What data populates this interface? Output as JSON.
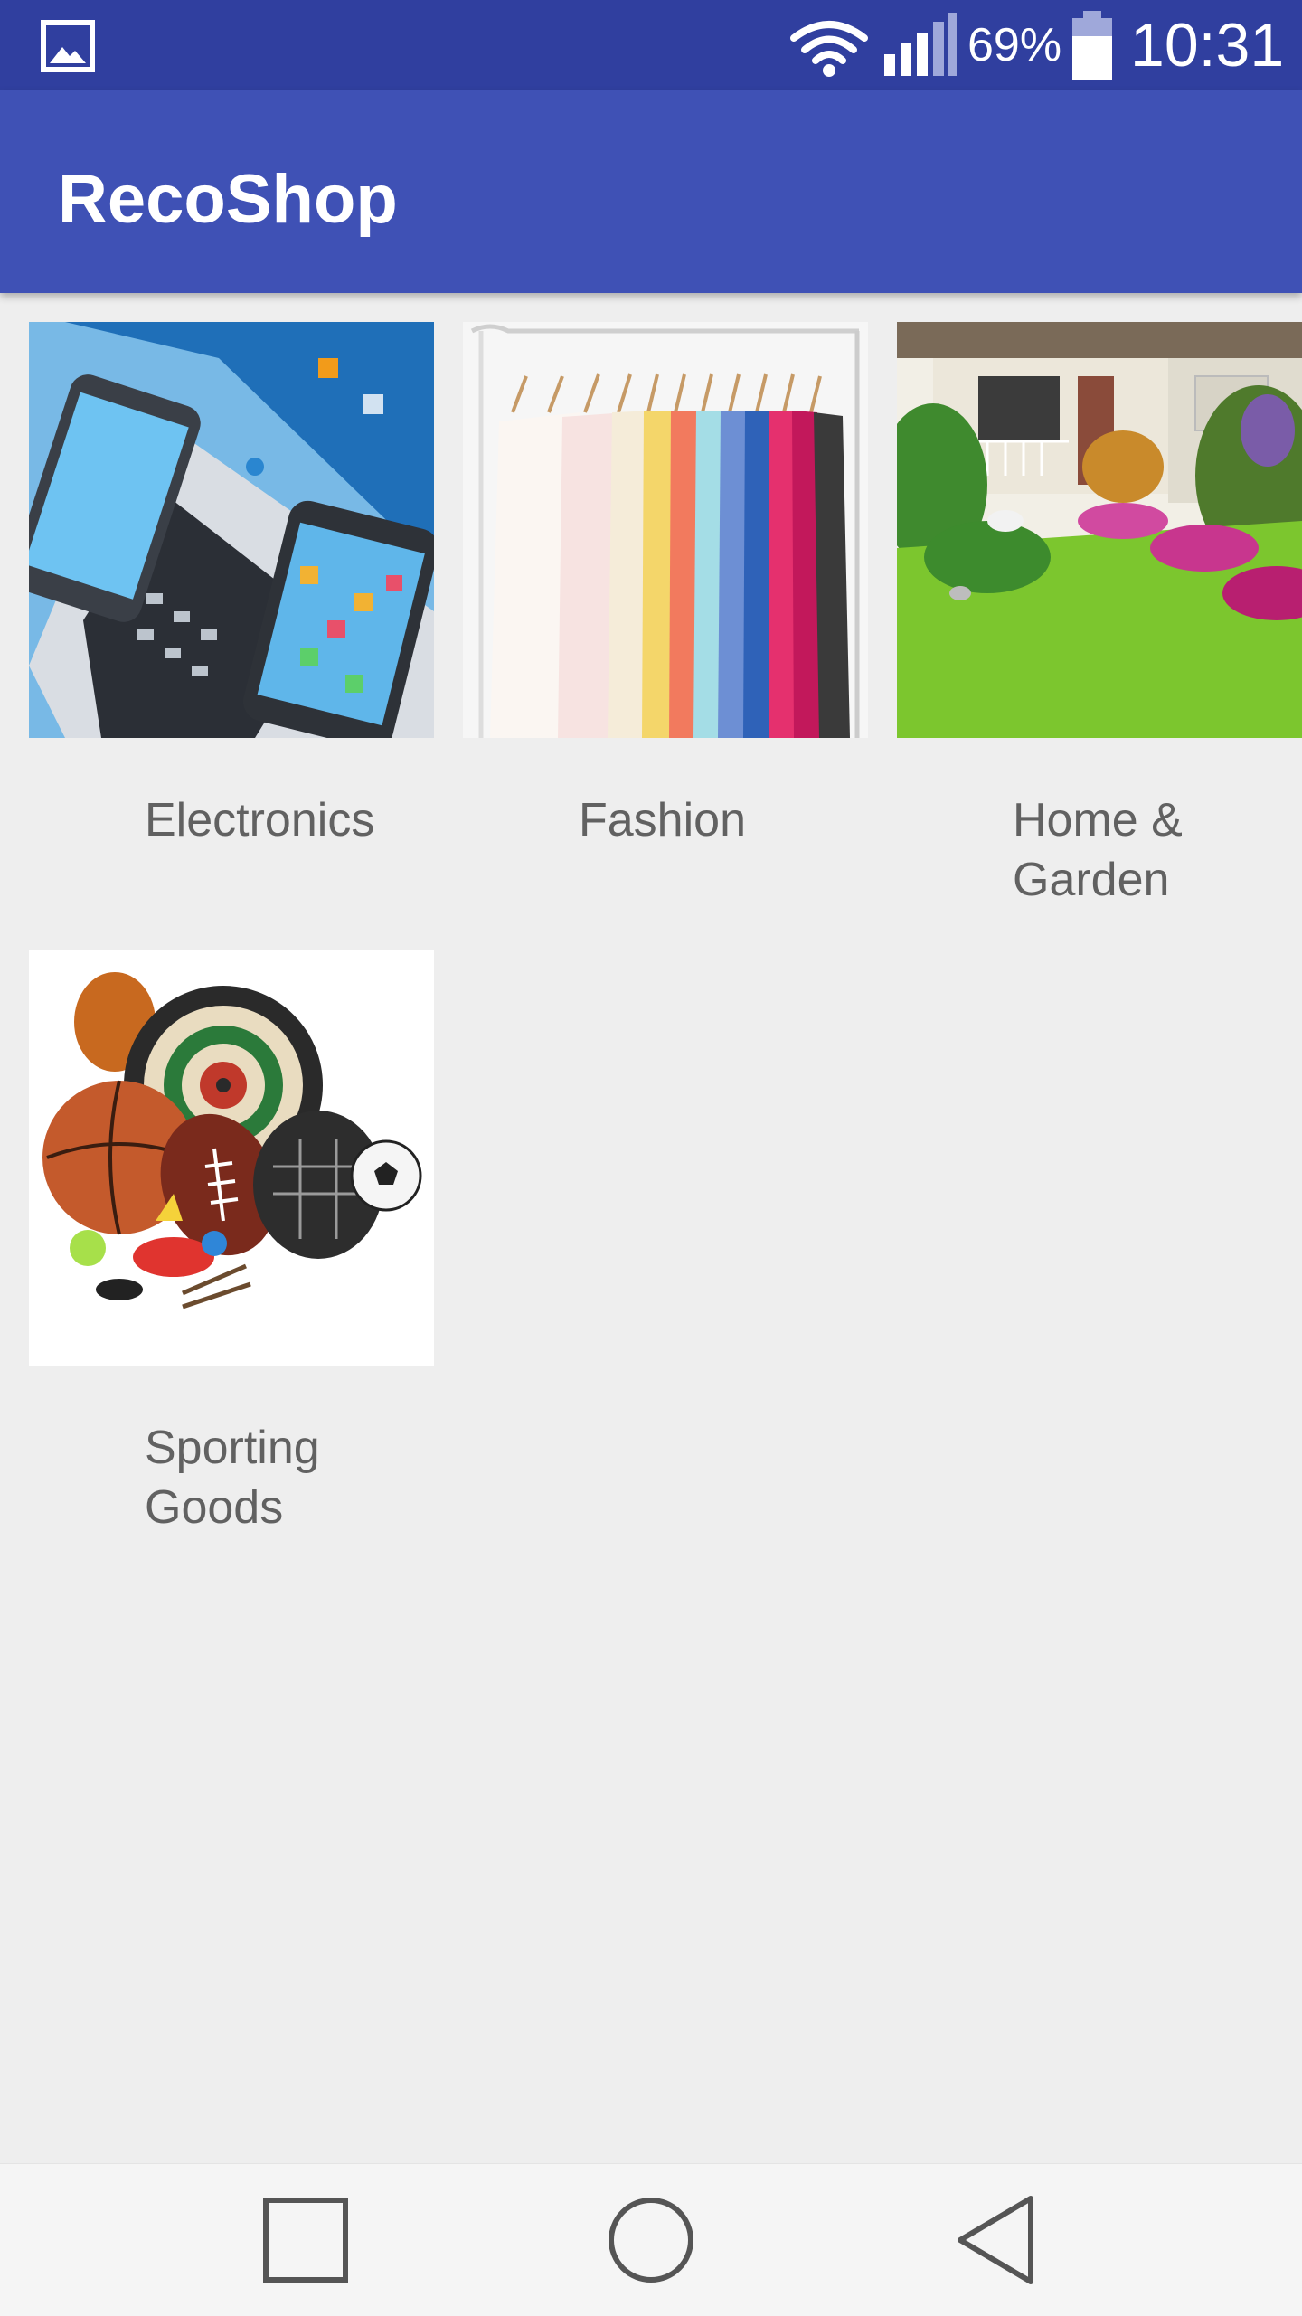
{
  "status_bar": {
    "battery_percent": "69%",
    "time": "10:31",
    "icons": [
      "gallery-notification-icon",
      "wifi-icon",
      "cell-signal-icon",
      "battery-icon"
    ]
  },
  "app_bar": {
    "title": "RecoShop"
  },
  "categories": [
    {
      "label": "Electronics",
      "image": "electronics-image"
    },
    {
      "label": "Fashion",
      "image": "fashion-image"
    },
    {
      "label": "Home &\nGarden",
      "image": "home-garden-image"
    },
    {
      "label": "Sporting\nGoods",
      "image": "sporting-goods-image"
    }
  ],
  "nav_bar": {
    "icons": [
      "recents-square-icon",
      "home-circle-icon",
      "back-triangle-icon"
    ]
  },
  "colors": {
    "status_bar": "#303f9f",
    "app_bar": "#3f51b5",
    "background": "#eeeeee",
    "label_text": "#616161"
  }
}
